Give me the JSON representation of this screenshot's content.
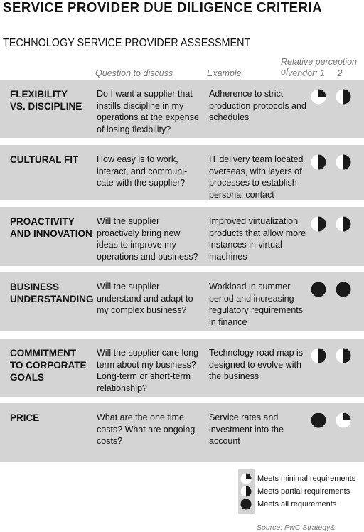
{
  "title": "SERVICE PROVIDER DUE DILIGENCE CRITERIA",
  "subtitle": "TECHNOLOGY SERVICE PROVIDER ASSESSMENT",
  "headers": {
    "question": "Question to discuss",
    "example": "Example",
    "perception_line1": "Relative perception of",
    "perception_line2": "vendor: 1     2"
  },
  "rows": [
    {
      "category": "FLEXIBILITY\nVS. DISCIPLINE",
      "question": "Do I want a supplier that instills discipline in my operations at the expense of losing flexibility?",
      "example": "Adherence to strict production protocols and schedules",
      "vendor1": "minimal",
      "vendor2": "partial"
    },
    {
      "category": "CULTURAL FIT",
      "question": "How easy is to work, interact, and communi-cate with the supplier?",
      "example": "IT delivery team located overseas, with layers of processes to establish personal contact",
      "vendor1": "partial",
      "vendor2": "partial"
    },
    {
      "category": "PROACTIVITY\nAND INNOVATION",
      "question": "Will the supplier proactively bring new ideas to improve my operations and business?",
      "example": "Improved virtualization products that allow more instances in virtual machines",
      "vendor1": "partial",
      "vendor2": "partial"
    },
    {
      "category": "BUSINESS\nUNDERSTANDING",
      "question": "Will the supplier understand and adapt to my complex business?",
      "example": "Workload in summer period and increasing regulatory requirements in finance",
      "vendor1": "all",
      "vendor2": "all"
    },
    {
      "category": "COMMITMENT\nTO CORPORATE\nGOALS",
      "question": "Will the supplier care long term about my business? Long-term or short-term relationship?",
      "example": "Technology road map is designed to evolve with the business",
      "vendor1": "partial",
      "vendor2": "partial"
    },
    {
      "category": "PRICE",
      "question": "What are the one time costs? What are ongoing costs?",
      "example": "Service rates and investment into the account",
      "vendor1": "all",
      "vendor2": "minimal"
    }
  ],
  "legend": [
    {
      "level": "minimal",
      "label": "Meets minimal requirements"
    },
    {
      "level": "partial",
      "label": "Meets partial requirements"
    },
    {
      "level": "all",
      "label": "Meets all requirements"
    }
  ],
  "source": "Source: PwC Strategy&",
  "colors": {
    "row_bg": "#d4d4d4",
    "fill": "#1a1a1a"
  }
}
